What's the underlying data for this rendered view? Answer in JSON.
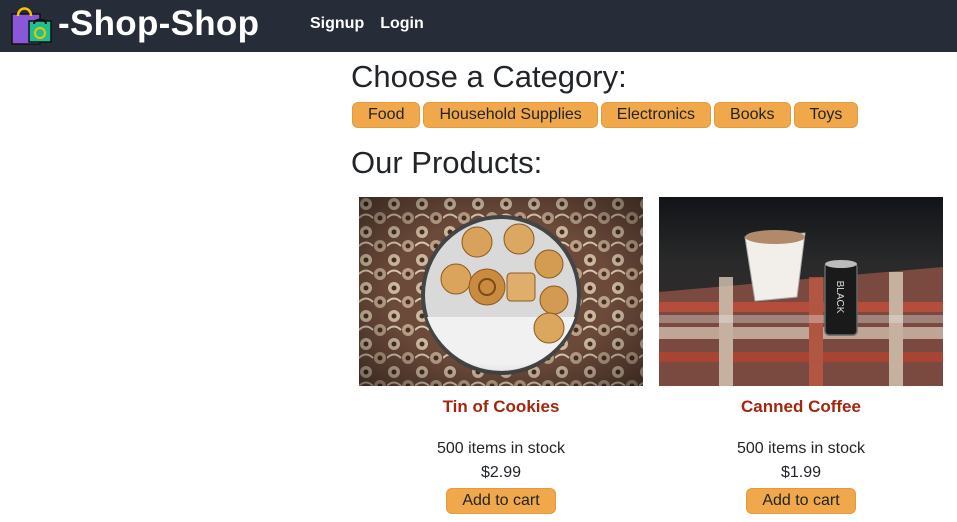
{
  "header": {
    "brand": "-Shop-Shop",
    "links": [
      "Signup",
      "Login"
    ]
  },
  "categories": {
    "heading": "Choose a Category:",
    "items": [
      "Food",
      "Household Supplies",
      "Electronics",
      "Books",
      "Toys"
    ]
  },
  "products": {
    "heading": "Our Products:",
    "items": [
      {
        "name": "Tin of Cookies",
        "stock": "500 items in stock",
        "price": "$2.99",
        "button": "Add to cart",
        "image": "cookies-photo"
      },
      {
        "name": "Canned Coffee",
        "stock": "500 items in stock",
        "price": "$1.99",
        "button": "Add to cart",
        "image": "coffee-photo"
      }
    ]
  },
  "colors": {
    "navbar": "#272d38",
    "accent": "#f0a84a",
    "product_name": "#a3260e"
  }
}
